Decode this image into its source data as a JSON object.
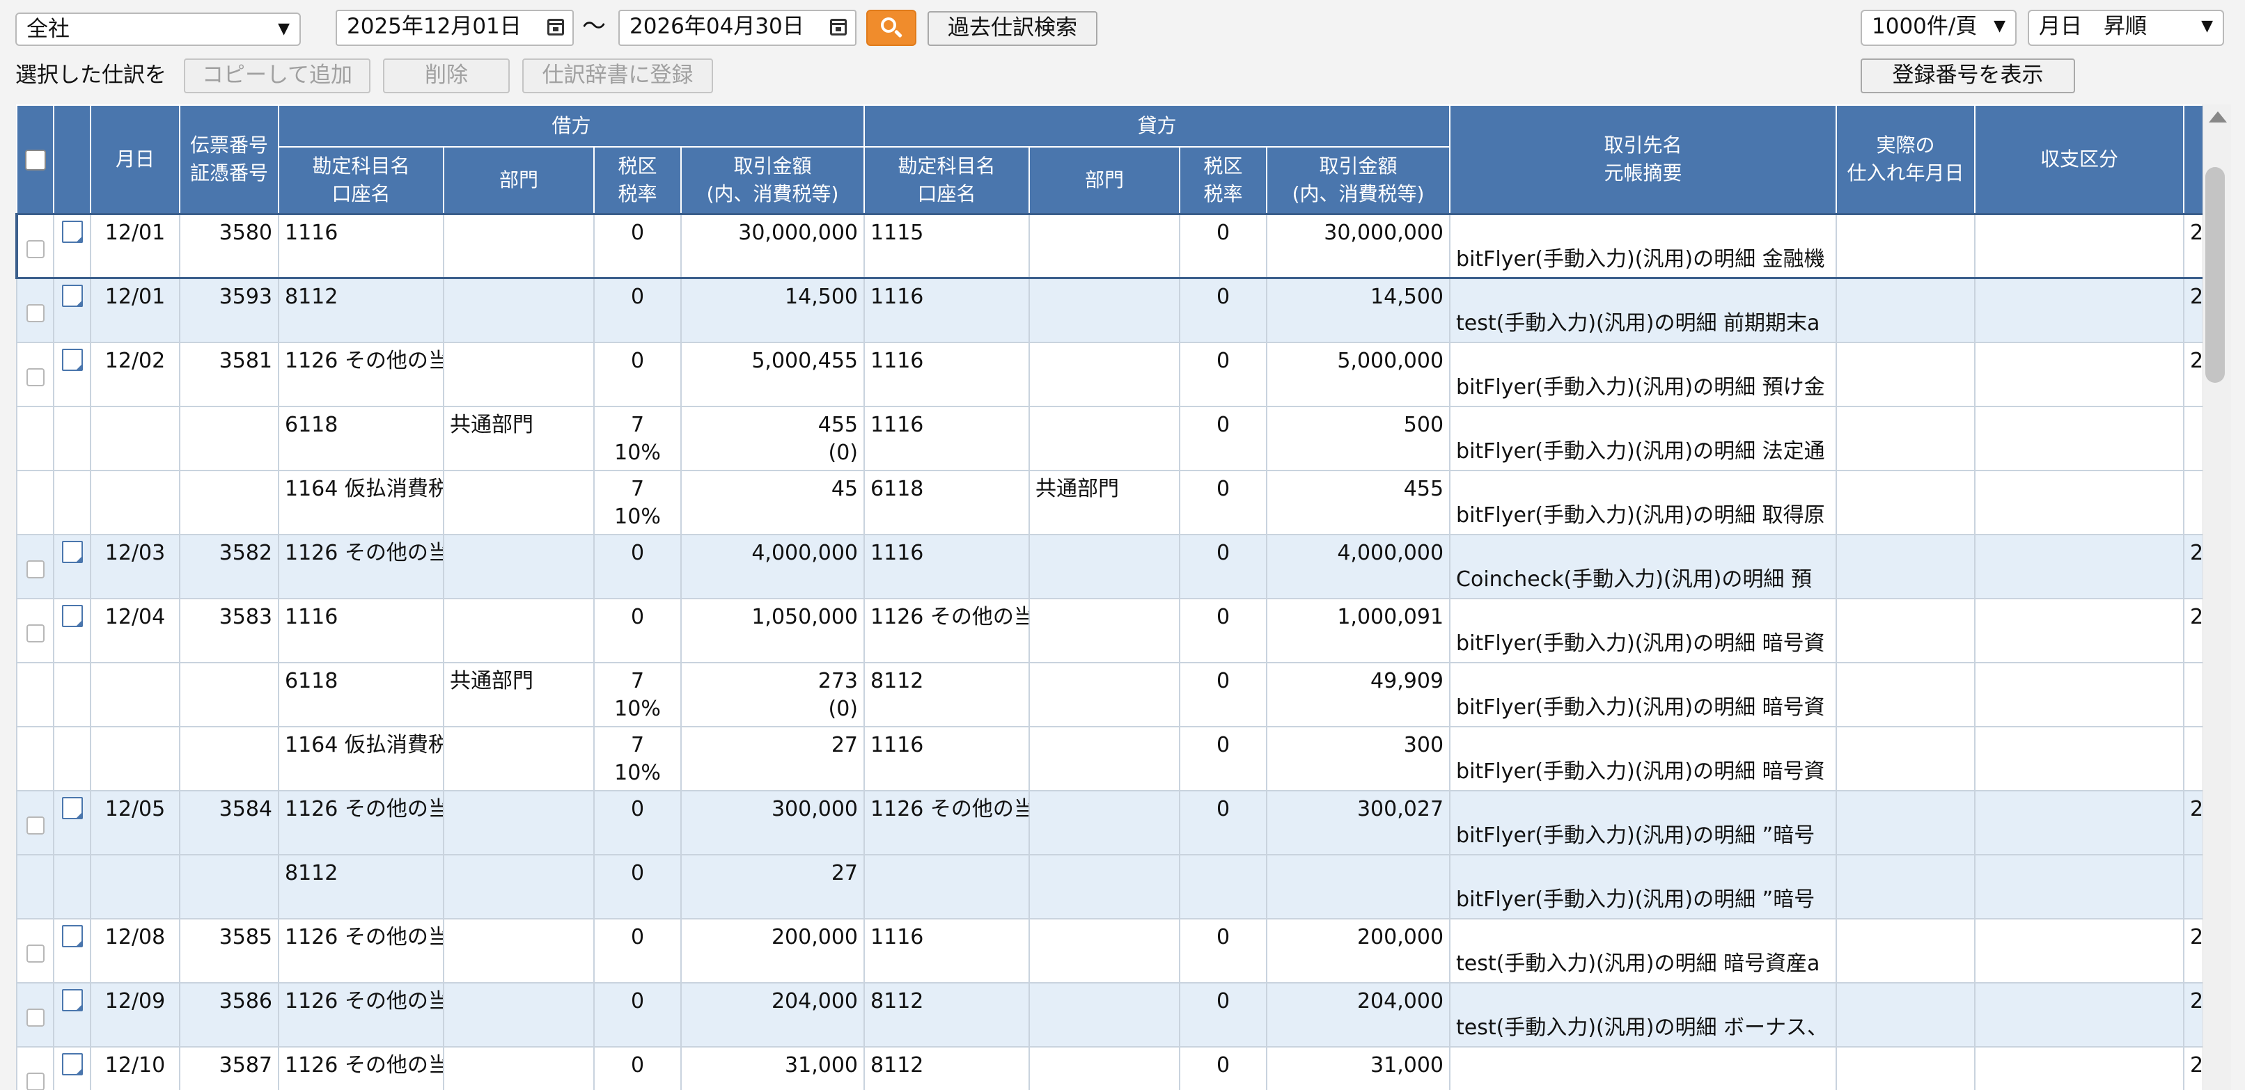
{
  "toolbar": {
    "company": "全社",
    "date_from": "2025年12月01日",
    "range_sep": "〜",
    "date_to": "2026年04月30日",
    "past_search": "過去仕訳検索",
    "per_page": "1000件/頁",
    "sort": "月日　昇順",
    "selected_label": "選択した仕訳を",
    "copy_add": "コピーして追加",
    "delete": "削除",
    "register_dict": "仕訳辞書に登録",
    "show_reg_number": "登録番号を表示"
  },
  "headers": {
    "date": "月日",
    "voucher1": "伝票番号",
    "voucher2": "証憑番号",
    "debit": "借方",
    "credit": "貸方",
    "account1": "勘定科目名",
    "account2": "口座名",
    "dept": "部門",
    "tax1": "税区",
    "tax2": "税率",
    "amount1": "取引金額",
    "amount2": "(内、消費税等)",
    "partner1": "取引先名",
    "partner2": "元帳摘要",
    "actual1": "実際の",
    "actual2": "仕入れ年月日",
    "income": "収支区分"
  },
  "rows": [
    {
      "style": "wht",
      "first": true,
      "date": "12/01",
      "no": "3580",
      "d_acct": "1116",
      "d_dept": "",
      "d_tax": "0",
      "d_rate": "",
      "d_amt": "30,000,000",
      "d_sub": "",
      "c_acct": "1115",
      "c_dept": "",
      "c_tax": "0",
      "c_amt": "30,000,000",
      "desc": "bitFlyer(手動入力)(汎用)の明細 金融機",
      "edge": "2"
    },
    {
      "style": "alt",
      "first": true,
      "date": "12/01",
      "no": "3593",
      "d_acct": "8112",
      "d_dept": "",
      "d_tax": "0",
      "d_rate": "",
      "d_amt": "14,500",
      "d_sub": "",
      "c_acct": "1116",
      "c_dept": "",
      "c_tax": "0",
      "c_amt": "14,500",
      "desc": "test(手動入力)(汎用)の明細 前期期末a",
      "edge": "2"
    },
    {
      "style": "wht",
      "first": true,
      "date": "12/02",
      "no": "3581",
      "d_acct": "1126 その他の当",
      "d_dept": "",
      "d_tax": "0",
      "d_rate": "",
      "d_amt": "5,000,455",
      "d_sub": "",
      "c_acct": "1116",
      "c_dept": "",
      "c_tax": "0",
      "c_amt": "5,000,000",
      "desc": "bitFlyer(手動入力)(汎用)の明細 預け金",
      "edge": "2"
    },
    {
      "style": "wht",
      "first": false,
      "date": "",
      "no": "",
      "d_acct": "6118",
      "d_dept": "共通部門",
      "d_tax": "7",
      "d_rate": "10%",
      "d_amt": "455",
      "d_sub": "(0)",
      "c_acct": "1116",
      "c_dept": "",
      "c_tax": "0",
      "c_amt": "500",
      "desc": "bitFlyer(手動入力)(汎用)の明細 法定通",
      "edge": ""
    },
    {
      "style": "wht",
      "first": false,
      "date": "",
      "no": "",
      "d_acct": "1164 仮払消費税",
      "d_dept": "",
      "d_tax": "7",
      "d_rate": "10%",
      "d_amt": "45",
      "d_sub": "",
      "c_acct": "6118",
      "c_dept": "共通部門",
      "c_tax": "0",
      "c_amt": "455",
      "desc": "bitFlyer(手動入力)(汎用)の明細 取得原",
      "edge": ""
    },
    {
      "style": "alt",
      "first": true,
      "date": "12/03",
      "no": "3582",
      "d_acct": "1126 その他の当",
      "d_dept": "",
      "d_tax": "0",
      "d_rate": "",
      "d_amt": "4,000,000",
      "d_sub": "",
      "c_acct": "1116",
      "c_dept": "",
      "c_tax": "0",
      "c_amt": "4,000,000",
      "desc": "Coincheck(手動入力)(汎用)の明細 預",
      "edge": "2"
    },
    {
      "style": "wht",
      "first": true,
      "date": "12/04",
      "no": "3583",
      "d_acct": "1116",
      "d_dept": "",
      "d_tax": "0",
      "d_rate": "",
      "d_amt": "1,050,000",
      "d_sub": "",
      "c_acct": "1126 その他の当",
      "c_dept": "",
      "c_tax": "0",
      "c_amt": "1,000,091",
      "desc": "bitFlyer(手動入力)(汎用)の明細 暗号資",
      "edge": "2"
    },
    {
      "style": "wht",
      "first": false,
      "date": "",
      "no": "",
      "d_acct": "6118",
      "d_dept": "共通部門",
      "d_tax": "7",
      "d_rate": "10%",
      "d_amt": "273",
      "d_sub": "(0)",
      "c_acct": "8112",
      "c_dept": "",
      "c_tax": "0",
      "c_amt": "49,909",
      "desc": "bitFlyer(手動入力)(汎用)の明細 暗号資",
      "edge": ""
    },
    {
      "style": "wht",
      "first": false,
      "date": "",
      "no": "",
      "d_acct": "1164 仮払消費税",
      "d_dept": "",
      "d_tax": "7",
      "d_rate": "10%",
      "d_amt": "27",
      "d_sub": "",
      "c_acct": "1116",
      "c_dept": "",
      "c_tax": "0",
      "c_amt": "300",
      "desc": "bitFlyer(手動入力)(汎用)の明細 暗号資",
      "edge": ""
    },
    {
      "style": "alt",
      "first": true,
      "date": "12/05",
      "no": "3584",
      "d_acct": "1126 その他の当",
      "d_dept": "",
      "d_tax": "0",
      "d_rate": "",
      "d_amt": "300,000",
      "d_sub": "",
      "c_acct": "1126 その他の当",
      "c_dept": "",
      "c_tax": "0",
      "c_amt": "300,027",
      "desc": "bitFlyer(手動入力)(汎用)の明細 ”暗号",
      "edge": "2"
    },
    {
      "style": "alt",
      "first": false,
      "date": "",
      "no": "",
      "d_acct": "8112",
      "d_dept": "",
      "d_tax": "0",
      "d_rate": "",
      "d_amt": "27",
      "d_sub": "",
      "c_acct": "",
      "c_dept": "",
      "c_tax": "",
      "c_amt": "",
      "desc": "bitFlyer(手動入力)(汎用)の明細 ”暗号",
      "edge": ""
    },
    {
      "style": "wht",
      "first": true,
      "date": "12/08",
      "no": "3585",
      "d_acct": "1126 その他の当",
      "d_dept": "",
      "d_tax": "0",
      "d_rate": "",
      "d_amt": "200,000",
      "d_sub": "",
      "c_acct": "1116",
      "c_dept": "",
      "c_tax": "0",
      "c_amt": "200,000",
      "desc": "test(手動入力)(汎用)の明細 暗号資産a",
      "edge": "2"
    },
    {
      "style": "alt",
      "first": true,
      "date": "12/09",
      "no": "3586",
      "d_acct": "1126 その他の当",
      "d_dept": "",
      "d_tax": "0",
      "d_rate": "",
      "d_amt": "204,000",
      "d_sub": "",
      "c_acct": "8112",
      "c_dept": "",
      "c_tax": "0",
      "c_amt": "204,000",
      "desc": "test(手動入力)(汎用)の明細 ボーナス、",
      "edge": "2"
    },
    {
      "style": "wht",
      "first": true,
      "date": "12/10",
      "no": "3587",
      "d_acct": "1126 その他の当",
      "d_dept": "",
      "d_tax": "0",
      "d_rate": "",
      "d_amt": "31,000",
      "d_sub": "",
      "c_acct": "8112",
      "c_dept": "",
      "c_tax": "0",
      "c_amt": "31,000",
      "desc": "",
      "edge": "2"
    }
  ]
}
